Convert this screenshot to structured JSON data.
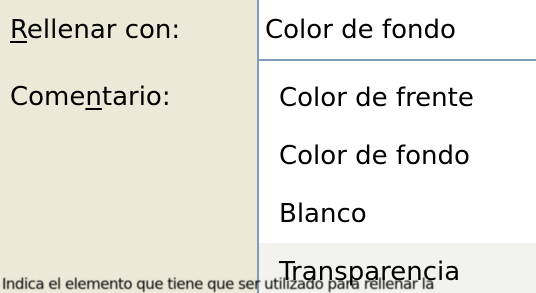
{
  "form": {
    "fill_label_underlined": "R",
    "fill_label_rest": "ellenar con:",
    "comment_label_before": "Come",
    "comment_label_underlined": "n",
    "comment_label_after": "tario:"
  },
  "fill_combo": {
    "value": "Color de fondo"
  },
  "fill_options": [
    "Color de frente",
    "Color de fondo",
    "Blanco",
    "Transparencia"
  ],
  "bottom_text": "Indica el elemento que tiene que ser utilizado para rellenar la"
}
